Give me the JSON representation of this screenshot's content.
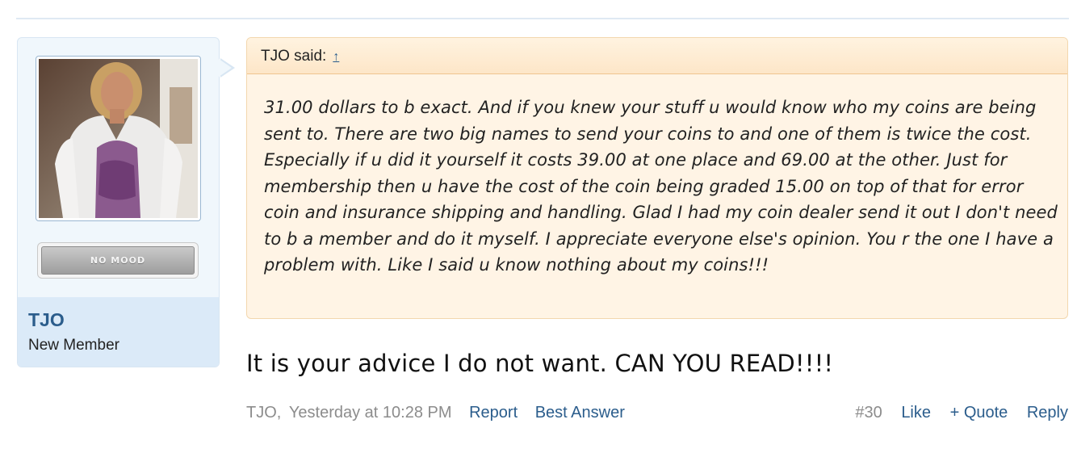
{
  "author": {
    "name": "TJO",
    "title": "New Member",
    "avatar_icon": "user-avatar-photo",
    "mood_label": "NO MOOD"
  },
  "quote": {
    "attribution": "TJO said:",
    "jump_icon": "↑",
    "text": "31.00 dollars to b exact. And if you knew your stuff u would know who my coins are being sent to. There are two big names to send your coins to and one of them is twice the cost. Especially if u did it yourself it costs 39.00 at one place and 69.00 at the other. Just for membership then u have the cost of the coin being graded 15.00 on top of that for error coin and insurance shipping and handling. Glad I had my coin dealer send it out I don't need to b a member and do it myself. I appreciate everyone else's opinion. You r the one I have a problem with. Like I said u know nothing about my coins!!!"
  },
  "message": {
    "text": "It is your advice I do not want. CAN YOU READ!!!!"
  },
  "meta": {
    "author": "TJO",
    "separator": ",",
    "timestamp": "Yesterday at 10:28 PM",
    "report": "Report",
    "best_answer": "Best Answer",
    "post_number": "#30",
    "like": "Like",
    "quote": "+ Quote",
    "reply": "Reply"
  },
  "colors": {
    "link": "#2b5d8c",
    "quote_background": "#fff4e5",
    "user_panel_background": "#f0f7fc"
  }
}
